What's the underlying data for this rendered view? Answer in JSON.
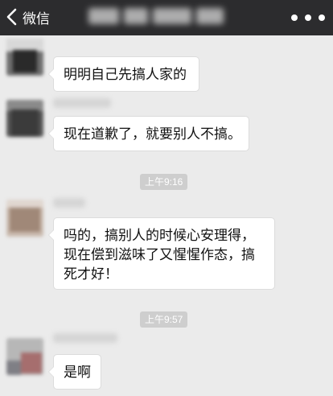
{
  "header": {
    "back_label": "微信",
    "back_icon": "chevron-left-icon",
    "more_icon": "more-dots-icon"
  },
  "messages": [
    {
      "text": "明明自己先搞人家的"
    },
    {
      "text": "现在道歉了，就要别人不搞。"
    },
    {
      "lines": [
        "吗的，搞别人的时候心安理得，",
        "现在偿到滋味了又惺惺作态，搞",
        "死才好！"
      ]
    },
    {
      "text": "是啊"
    }
  ],
  "timestamps": [
    "上午9:16",
    "上午9:57"
  ],
  "colors": {
    "topbar": "#2c2c2e",
    "chat_background": "#ebebeb",
    "bubble": "#ffffff",
    "timestamp_pill": "#cecece"
  }
}
